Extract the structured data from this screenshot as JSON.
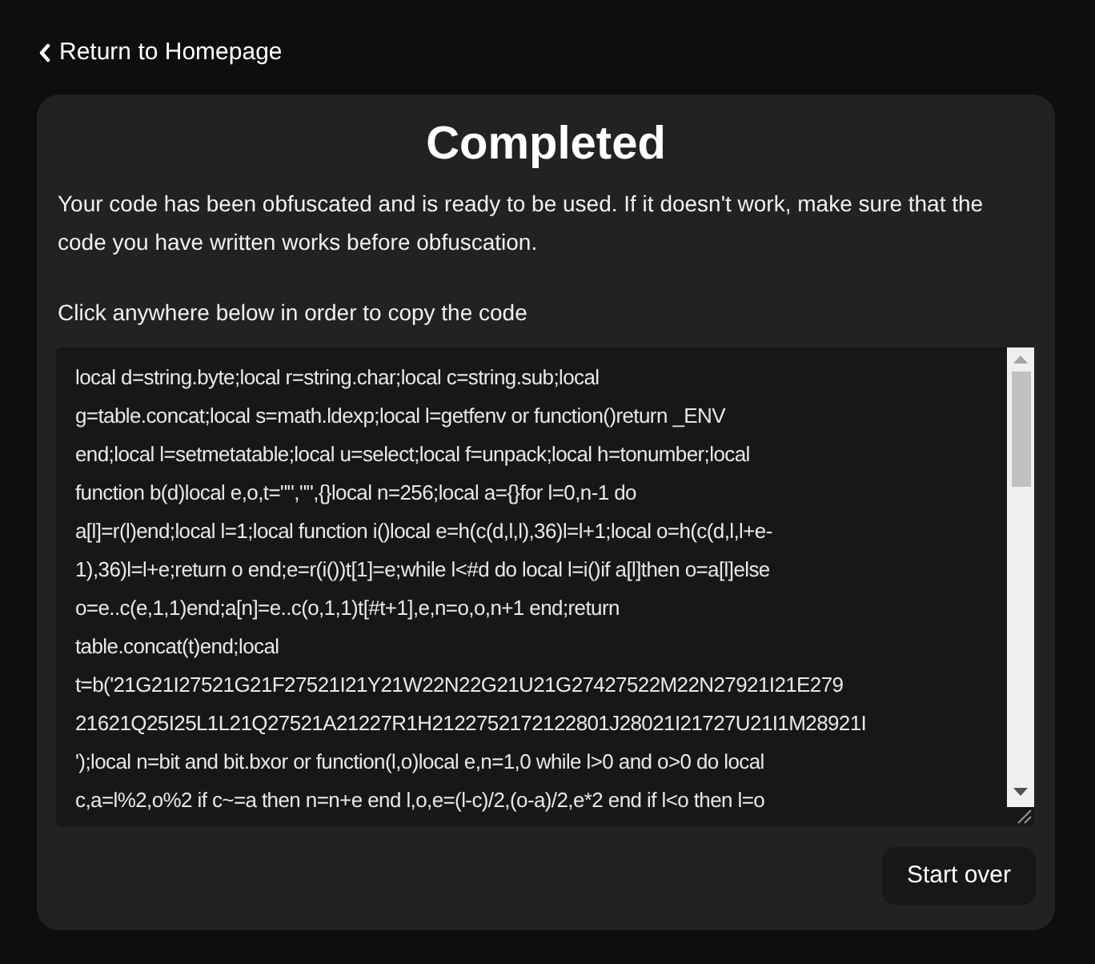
{
  "back_link": {
    "label": "Return to Homepage"
  },
  "card": {
    "title": "Completed",
    "message": "Your code has been obfuscated and is ready to be used. If it doesn't work, make sure that the code you have written works before obfuscation.",
    "copy_hint": "Click anywhere below in order to copy the code",
    "code_lines": [
      "local d=string.byte;local r=string.char;local c=string.sub;local",
      "g=table.concat;local s=math.ldexp;local l=getfenv or function()return _ENV",
      "end;local l=setmetatable;local u=select;local f=unpack;local h=tonumber;local",
      "function b(d)local e,o,t=\"\",\"\",{}local n=256;local a={}for l=0,n-1 do",
      "a[l]=r(l)end;local l=1;local function i()local e=h(c(d,l,l),36)l=l+1;local o=h(c(d,l,l+e-",
      "1),36)l=l+e;return o end;e=r(i())t[1]=e;while l<#d do local l=i()if a[l]then o=a[l]else",
      "o=e..c(e,1,1)end;a[n]=e..c(o,1,1)t[#t+1],e,n=o,o,n+1 end;return",
      "table.concat(t)end;local",
      "t=b('21G21I27521G21F27521I21Y21W22N22G21U21G27427522M22N27921I21E279",
      "21621Q25I25L1L21Q27521A21227R1H2122752172122801J28021I21727U21I1M28921I",
      "');local n=bit and bit.bxor or function(l,o)local e,n=1,0 while l>0 and o>0 do local",
      "c,a=l%2,o%2 if c~=a then n=n+e end l,o,e=(l-c)/2,(o-a)/2,e*2 end if l<o then l=o"
    ],
    "button": "Start over"
  }
}
